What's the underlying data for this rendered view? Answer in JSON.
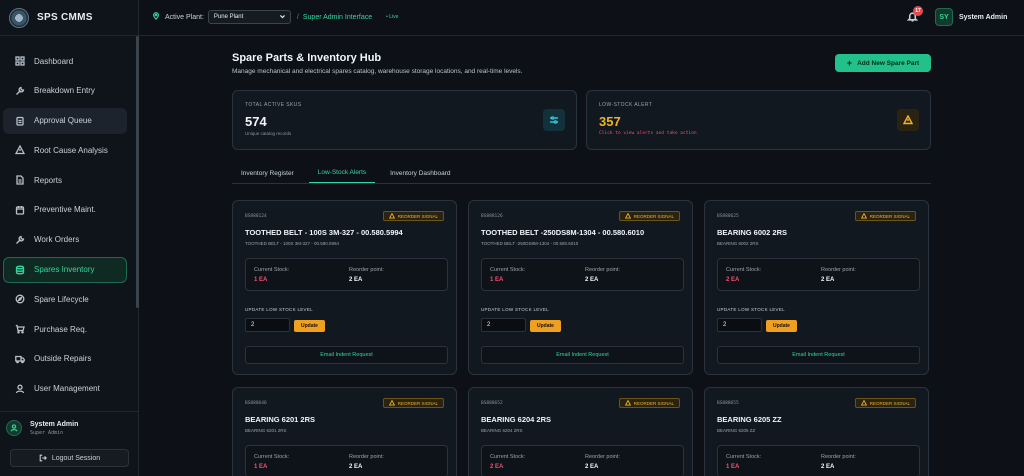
{
  "app": {
    "name": "SPS CMMS"
  },
  "sidebar": {
    "items": [
      {
        "label": "Dashboard",
        "icon": "grid-icon"
      },
      {
        "label": "Breakdown Entry",
        "icon": "wrench-icon"
      },
      {
        "label": "Approval Queue",
        "icon": "clipboard-icon"
      },
      {
        "label": "Root Cause Analysis",
        "icon": "warning-icon"
      },
      {
        "label": "Reports",
        "icon": "document-icon"
      },
      {
        "label": "Preventive Maint.",
        "icon": "calendar-icon"
      },
      {
        "label": "Work Orders",
        "icon": "wrench-icon"
      },
      {
        "label": "Spares Inventory",
        "icon": "database-icon"
      },
      {
        "label": "Spare Lifecycle",
        "icon": "compass-icon"
      },
      {
        "label": "Purchase Req.",
        "icon": "cart-icon"
      },
      {
        "label": "Outside Repairs",
        "icon": "truck-icon"
      },
      {
        "label": "User Management",
        "icon": "user-icon"
      }
    ],
    "user": {
      "name": "System Admin",
      "role": "Super Admin"
    },
    "logout_label": "Logout Session"
  },
  "topbar": {
    "plant_label": "Active Plant:",
    "plant_value": "Pune Plant",
    "separator": "/",
    "interface_label": "Super Admin Interface",
    "live_label": "• Live",
    "notif_count": "17",
    "user_initials": "SY",
    "user_name": "System Admin"
  },
  "main": {
    "title": "Spare Parts & Inventory Hub",
    "subtitle": "Manage mechanical and electrical spares catalog, warehouse storage locations, and real-time levels.",
    "add_button": "Add New Spare Part",
    "stats": {
      "total": {
        "label": "TOTAL ACTIVE SKUS",
        "value": "574",
        "sub": "Unique catalog records"
      },
      "low": {
        "label": "LOW-STOCK ALERT",
        "value": "357",
        "sub": "Click to view alerts and take action"
      }
    },
    "tabs": [
      "Inventory Register",
      "Low-Stock Alerts",
      "Inventory Dashboard"
    ],
    "active_tab": "Low-Stock Alerts"
  },
  "cards": [
    {
      "id": "BS888124",
      "signal": "REORDER SIGNAL",
      "title": "TOOTHED BELT - 100S 3M-327 - 00.580.5994",
      "desc": "TOOTHED BELT - 100S 3M-327 - 00.580.5994",
      "current_label": "Current Stock:",
      "current": "1 EA",
      "reorder_label": "Reorder point:",
      "reorder": "2 EA",
      "update_label": "UPDATE LOW STOCK LEVEL",
      "input": "2",
      "update_btn": "Update",
      "email_btn": "Email Indent Request"
    },
    {
      "id": "BS888126",
      "signal": "REORDER SIGNAL",
      "title": "TOOTHED BELT -250DS8M-1304 - 00.580.6010",
      "desc": "TOOTHED BELT -250DS8M-1304 - 00.580.6010",
      "current_label": "Current Stock:",
      "current": "1 EA",
      "reorder_label": "Reorder point:",
      "reorder": "2 EA",
      "update_label": "UPDATE LOW STOCK LEVEL",
      "input": "2",
      "update_btn": "Update",
      "email_btn": "Email Indent Request"
    },
    {
      "id": "BS888625",
      "signal": "REORDER SIGNAL",
      "title": "BEARING 6002 2RS",
      "desc": "BEARING 6002 2RS",
      "current_label": "Current Stock:",
      "current": "2 EA",
      "reorder_label": "Reorder point:",
      "reorder": "2 EA",
      "update_label": "UPDATE LOW STOCK LEVEL",
      "input": "2",
      "update_btn": "Update",
      "email_btn": "Email Indent Request"
    },
    {
      "id": "BS888646",
      "signal": "REORDER SIGNAL",
      "title": "BEARING 6201 2RS",
      "desc": "BEARING 6201 2RS",
      "current_label": "Current Stock:",
      "current": "1 EA",
      "reorder_label": "Reorder point:",
      "reorder": "2 EA"
    },
    {
      "id": "BS888652",
      "signal": "REORDER SIGNAL",
      "title": "BEARING 6204 2RS",
      "desc": "BEARING 6204 2RS",
      "current_label": "Current Stock:",
      "current": "2 EA",
      "reorder_label": "Reorder point:",
      "reorder": "2 EA"
    },
    {
      "id": "BS888655",
      "signal": "REORDER SIGNAL",
      "title": "BEARING 6205 ZZ",
      "desc": "BEARING 6205 ZZ",
      "current_label": "Current Stock:",
      "current": "1 EA",
      "reorder_label": "Reorder point:",
      "reorder": "2 EA"
    }
  ],
  "colors": {
    "accent": "#33d69f",
    "warning": "#f0b429",
    "danger": "#f0506e",
    "background": "#0d1117"
  }
}
